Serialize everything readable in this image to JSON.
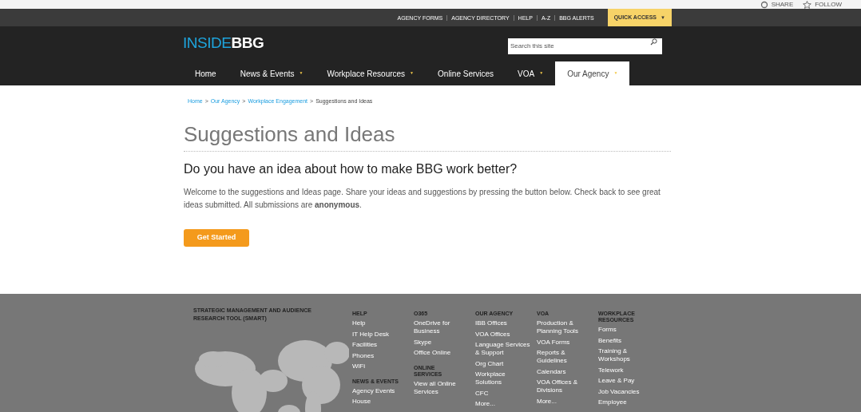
{
  "ribbon": {
    "actions": [
      {
        "label": "SHARE",
        "kind": "share"
      },
      {
        "label": "FOLLOW",
        "kind": "follow"
      }
    ]
  },
  "utility_bar": {
    "links": [
      "AGENCY FORMS",
      "AGENCY DIRECTORY",
      "HELP",
      "A-Z",
      "BBG ALERTS"
    ],
    "quick_access": {
      "label": "QUICK ACCESS",
      "caret": "▼"
    }
  },
  "header": {
    "logo": {
      "part1": "INSIDE",
      "part2": "BBG"
    },
    "search": {
      "placeholder": "Search this site"
    }
  },
  "nav": [
    {
      "label": "Home",
      "selected": false,
      "dropdown": false
    },
    {
      "label": "News & Events",
      "selected": false,
      "dropdown": true
    },
    {
      "label": "Workplace Resources",
      "selected": false,
      "dropdown": true
    },
    {
      "label": "Online Services",
      "selected": false,
      "dropdown": false
    },
    {
      "label": "VOA",
      "selected": false,
      "dropdown": true
    },
    {
      "label": "Our Agency",
      "selected": true,
      "dropdown": true
    }
  ],
  "nav_caret": "▼",
  "breadcrumb": {
    "links": [
      "Home",
      "Our Agency",
      "Workplace Engagement"
    ],
    "current": "Suggestions and Ideas",
    "separator": ">"
  },
  "page": {
    "title": "Suggestions and Ideas",
    "subtitle": "Do you have an idea about how to make BBG work better?",
    "body": "Welcome to the suggestions and Ideas page. Share your ideas and suggestions by pressing the button below. Check back to see great ideas submitted. All submissions are **anonymous**.",
    "button": "Get Started"
  },
  "footer": {
    "smart_title": "STRATEGIC MANAGEMENT AND AUDIENCE RESEARCH TOOL (SMART)",
    "columns": [
      {
        "sections": [
          {
            "heading": "HELP",
            "links": [
              "Help",
              "IT Help Desk",
              "Facilities",
              "Phones",
              "WiFi"
            ]
          },
          {
            "heading": "NEWS & EVENTS",
            "links": [
              "Agency Events",
              "House"
            ]
          }
        ]
      },
      {
        "sections": [
          {
            "heading": "O365",
            "links": [
              "OneDrive for Business",
              "Skype",
              "Office Online"
            ]
          },
          {
            "heading": "ONLINE SERVICES",
            "links": [
              "View all Online Services"
            ]
          }
        ]
      },
      {
        "sections": [
          {
            "heading": "OUR AGENCY",
            "links": [
              "IBB Offices",
              "VOA Offices",
              "Language Services & Support",
              "Org Chart",
              "Workplace Solutions",
              "CFC",
              "More..."
            ]
          }
        ]
      },
      {
        "sections": [
          {
            "heading": "VOA",
            "links": [
              "Production & Planning Tools",
              "VOA Forms",
              "Reports & Guidelines",
              "Calendars",
              "VOA Offices & Divisions",
              "More..."
            ]
          }
        ]
      },
      {
        "sections": [
          {
            "heading": "WORKPLACE RESOURCES",
            "links": [
              "Forms",
              "Benefits",
              "Training & Workshops",
              "Telework",
              "Leave & Pay",
              "Job Vacancies",
              "Employee"
            ]
          }
        ]
      }
    ]
  }
}
